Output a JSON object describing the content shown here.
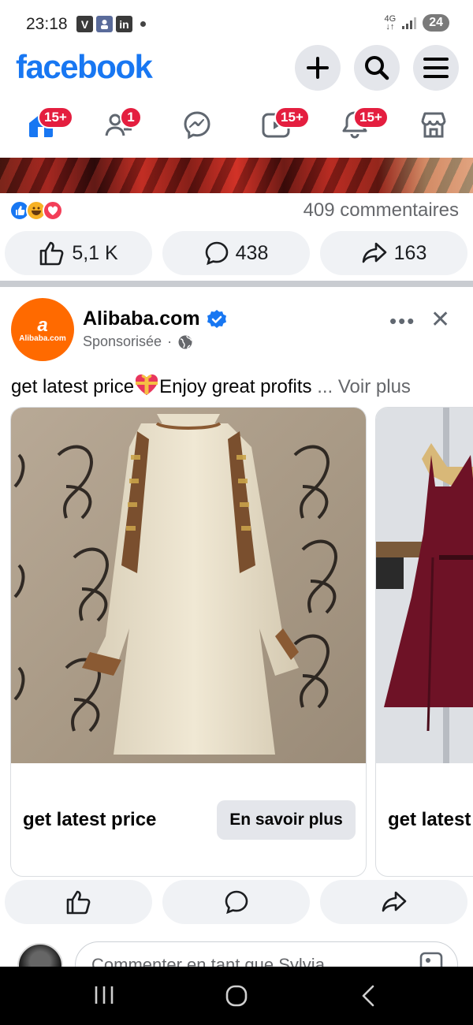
{
  "status_bar": {
    "time": "23:18",
    "app_icons": [
      "V",
      "in"
    ],
    "network": "4G",
    "battery": "24"
  },
  "header": {
    "logo": "facebook",
    "icons": [
      "plus-icon",
      "search-icon",
      "menu-icon"
    ]
  },
  "nav": {
    "items": [
      {
        "name": "home",
        "badge": "15+"
      },
      {
        "name": "friends",
        "badge": "1"
      },
      {
        "name": "messenger",
        "badge": ""
      },
      {
        "name": "video",
        "badge": "15+"
      },
      {
        "name": "notifications",
        "badge": "15+"
      },
      {
        "name": "marketplace",
        "badge": ""
      }
    ]
  },
  "previous_post": {
    "comments_count": "409 commentaires",
    "likes": "5,1 K",
    "comments": "438",
    "shares": "163"
  },
  "ad_post": {
    "page_name": "Alibaba.com",
    "avatar_text": "Alibaba.com",
    "sponsored_label": "Sponsorisée",
    "text_part1": "get latest price",
    "text_part2": "Enjoy great profits",
    "see_more": "... Voir plus",
    "cards": [
      {
        "headline": "get latest price",
        "cta": "En savoir plus"
      },
      {
        "headline": "get latest price",
        "cta": ""
      }
    ]
  },
  "comment_box": {
    "placeholder": "Commenter en tant que Sylvia"
  },
  "colors": {
    "brand": "#1877f2",
    "badge": "#e41e3f",
    "alibaba": "#ff6a00",
    "pill_bg": "#f0f2f5"
  }
}
